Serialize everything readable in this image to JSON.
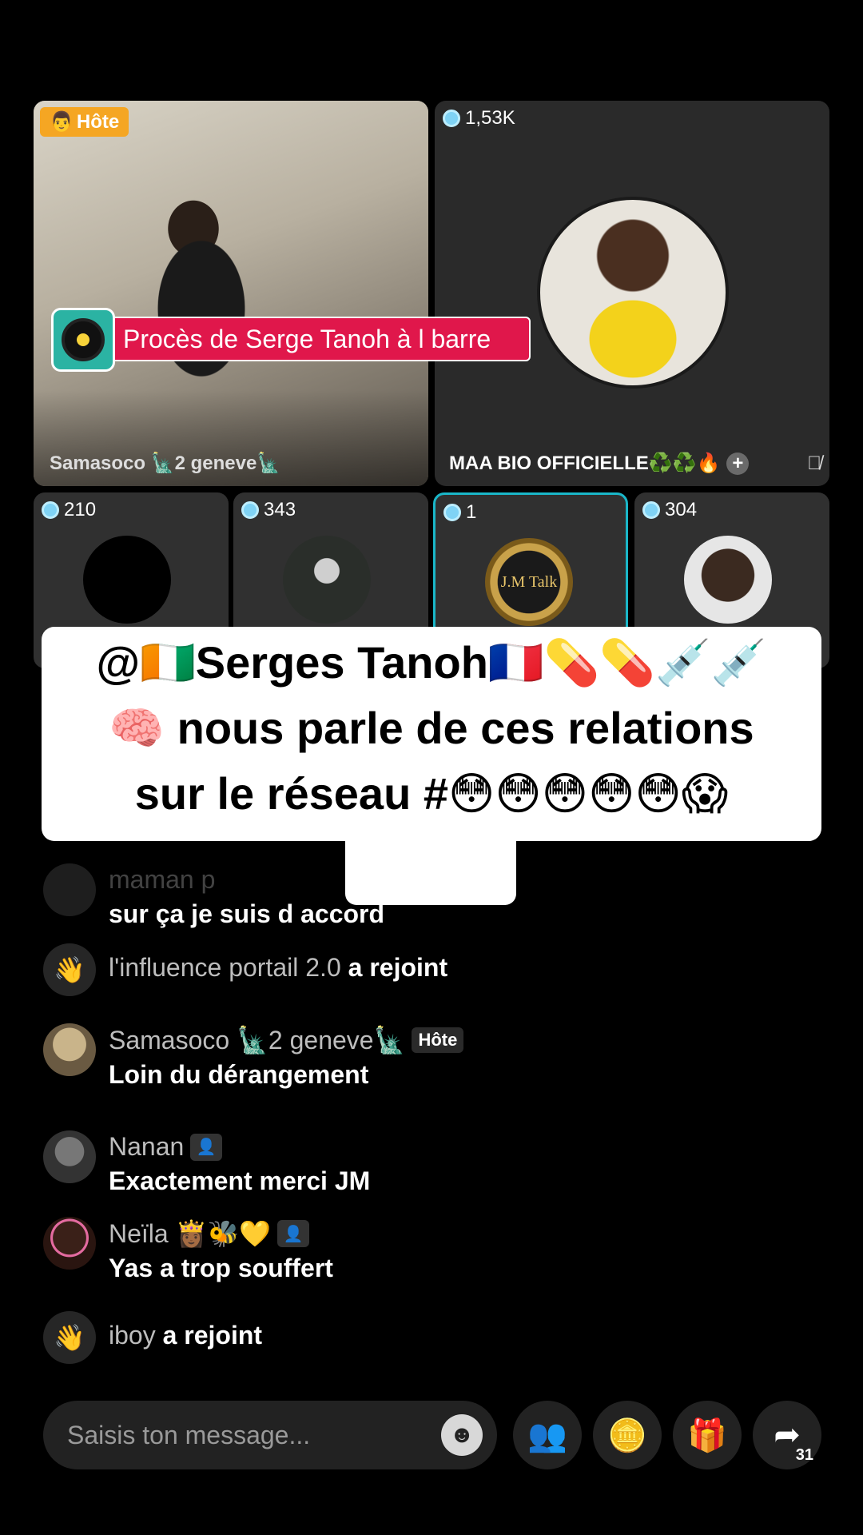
{
  "stage": {
    "host": {
      "badge": "Hôte",
      "name": "Samasoco 🗽2 geneve🗽",
      "music_title": "Procès de Serge Tanoh à l barre"
    },
    "guest_main": {
      "coins": "1,53K",
      "name": "MAA BIO OFFICIELLE♻️♻️🔥"
    },
    "small_guests": [
      {
        "coins": "210"
      },
      {
        "coins": "343"
      },
      {
        "coins": "1",
        "avatar_text": "J.M Talk"
      },
      {
        "coins": "304"
      }
    ]
  },
  "overlay": {
    "line1": "@🇨🇮Serges Tanoh🇫🇷💊💊💉💉",
    "line2": "🧠 nous parle de ces relations",
    "line3": "sur le réseau #😳😳😳😳😳😱",
    "line4": "😱😱"
  },
  "chat": {
    "partial_user": "maman p",
    "partial_msg": "sur ça je suis d accord",
    "join1_user": "l'influence portail 2.0",
    "join_suffix": "a rejoint",
    "msg1_user": "Samasoco 🗽2 geneve🗽",
    "msg1_tag": "Hôte",
    "msg1_text": "Loin du dérangement",
    "msg2_user": "Nanan",
    "msg2_text": "Exactement merci JM",
    "msg3_user": "Neïla 👸🏾🐝💛",
    "msg3_text": "Yas a trop souffert",
    "join2_user": "iboy"
  },
  "bottom": {
    "placeholder": "Saisis ton message...",
    "share_count": "31"
  },
  "colors": {
    "accent_pink": "#e0174b",
    "host_badge": "#f5a623",
    "active_border": "#1ab7c9"
  }
}
